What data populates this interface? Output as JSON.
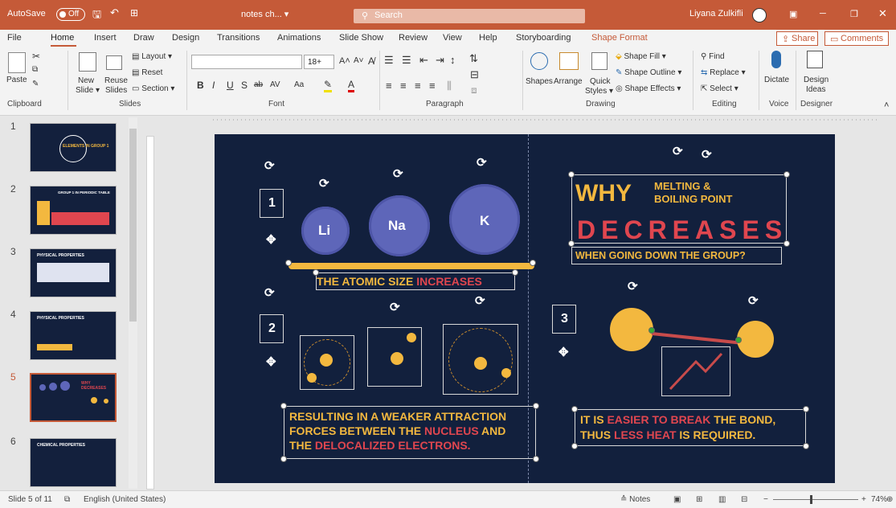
{
  "titlebar": {
    "autosave_label": "AutoSave",
    "autosave_state": "Off",
    "doc_title": "notes ch... ▾",
    "search_placeholder": "Search",
    "user_name": "Liyana Zulkifli",
    "accent_color": "#c55a38"
  },
  "tabs": [
    {
      "label": "File"
    },
    {
      "label": "Home"
    },
    {
      "label": "Insert"
    },
    {
      "label": "Draw"
    },
    {
      "label": "Design"
    },
    {
      "label": "Transitions"
    },
    {
      "label": "Animations"
    },
    {
      "label": "Slide Show"
    },
    {
      "label": "Review"
    },
    {
      "label": "View"
    },
    {
      "label": "Help"
    },
    {
      "label": "Storyboarding"
    },
    {
      "label": "Shape Format"
    }
  ],
  "share_label": "Share",
  "comments_label": "Comments",
  "ribbon": {
    "clipboard": {
      "label": "Clipboard",
      "paste": "Paste"
    },
    "slides": {
      "label": "Slides",
      "new_slide_1": "New",
      "new_slide_2": "Slide ▾",
      "reuse_1": "Reuse",
      "reuse_2": "Slides",
      "layout": "Layout ▾",
      "reset": "Reset",
      "section": "Section ▾"
    },
    "font": {
      "label": "Font",
      "size": "18+",
      "b": "B",
      "i": "I",
      "u": "U",
      "s": "S",
      "ab": "ab",
      "av": "AV",
      "aa": "Aa"
    },
    "paragraph": {
      "label": "Paragraph"
    },
    "drawing": {
      "label": "Drawing",
      "shapes": "Shapes",
      "arrange": "Arrange",
      "quick_styles_1": "Quick",
      "quick_styles_2": "Styles ▾",
      "shape_fill": "Shape Fill ▾",
      "shape_outline": "Shape Outline ▾",
      "shape_effects": "Shape Effects ▾"
    },
    "editing": {
      "label": "Editing",
      "find": "Find",
      "replace": "Replace ▾",
      "select": "Select ▾"
    },
    "voice": {
      "label": "Voice",
      "dictate": "Dictate"
    },
    "designer": {
      "label": "Designer",
      "design_ideas_1": "Design",
      "design_ideas_2": "Ideas"
    }
  },
  "thumbnails": [
    {
      "num": "1",
      "text": "ELEMENTS IN GROUP 1"
    },
    {
      "num": "2",
      "text": "GROUP 1 IN PERIODIC TABLE"
    },
    {
      "num": "3",
      "text": "PHYSICAL PROPERTIES"
    },
    {
      "num": "4",
      "text": "PHYSICAL PROPERTIES"
    },
    {
      "num": "5",
      "text": "WHY DECREASES"
    },
    {
      "num": "6",
      "text": "CHEMICAL PROPERTIES"
    }
  ],
  "slide": {
    "li": "Li",
    "na": "Na",
    "k": "K",
    "step1": "1",
    "step2": "2",
    "step3": "3",
    "why": "WHY",
    "melting_1": "MELTING &",
    "melting_2": "BOILING POINT",
    "decreases": "DECREASES",
    "going_down": "WHEN GOING DOWN THE GROUP?",
    "atomic_size": "THE ATOMIC SIZE ",
    "increases": "INCREASES",
    "weaker_1": "RESULTING IN A WEAKER ATTRACTION",
    "weaker_2a": "FORCES BETWEEN THE ",
    "weaker_2b": "NUCLEUS",
    "weaker_2c": " AND",
    "weaker_3a": "THE ",
    "weaker_3b": "DELOCALIZED ELECTRONS.",
    "easier_1a": "IT IS ",
    "easier_1b": "EASIER TO BREAK",
    "easier_1c": " THE BOND,",
    "easier_2a": "THUS ",
    "easier_2b": "LESS HEAT",
    "easier_2c": " IS REQUIRED.",
    "colors": {
      "bg": "#12203d",
      "yellow": "#f3b83f",
      "red": "#e0464f",
      "blue": "#5e66b9"
    }
  },
  "status": {
    "slide_info": "Slide 5 of 11",
    "language": "English (United States)",
    "notes": "Notes",
    "zoom": "74%"
  }
}
